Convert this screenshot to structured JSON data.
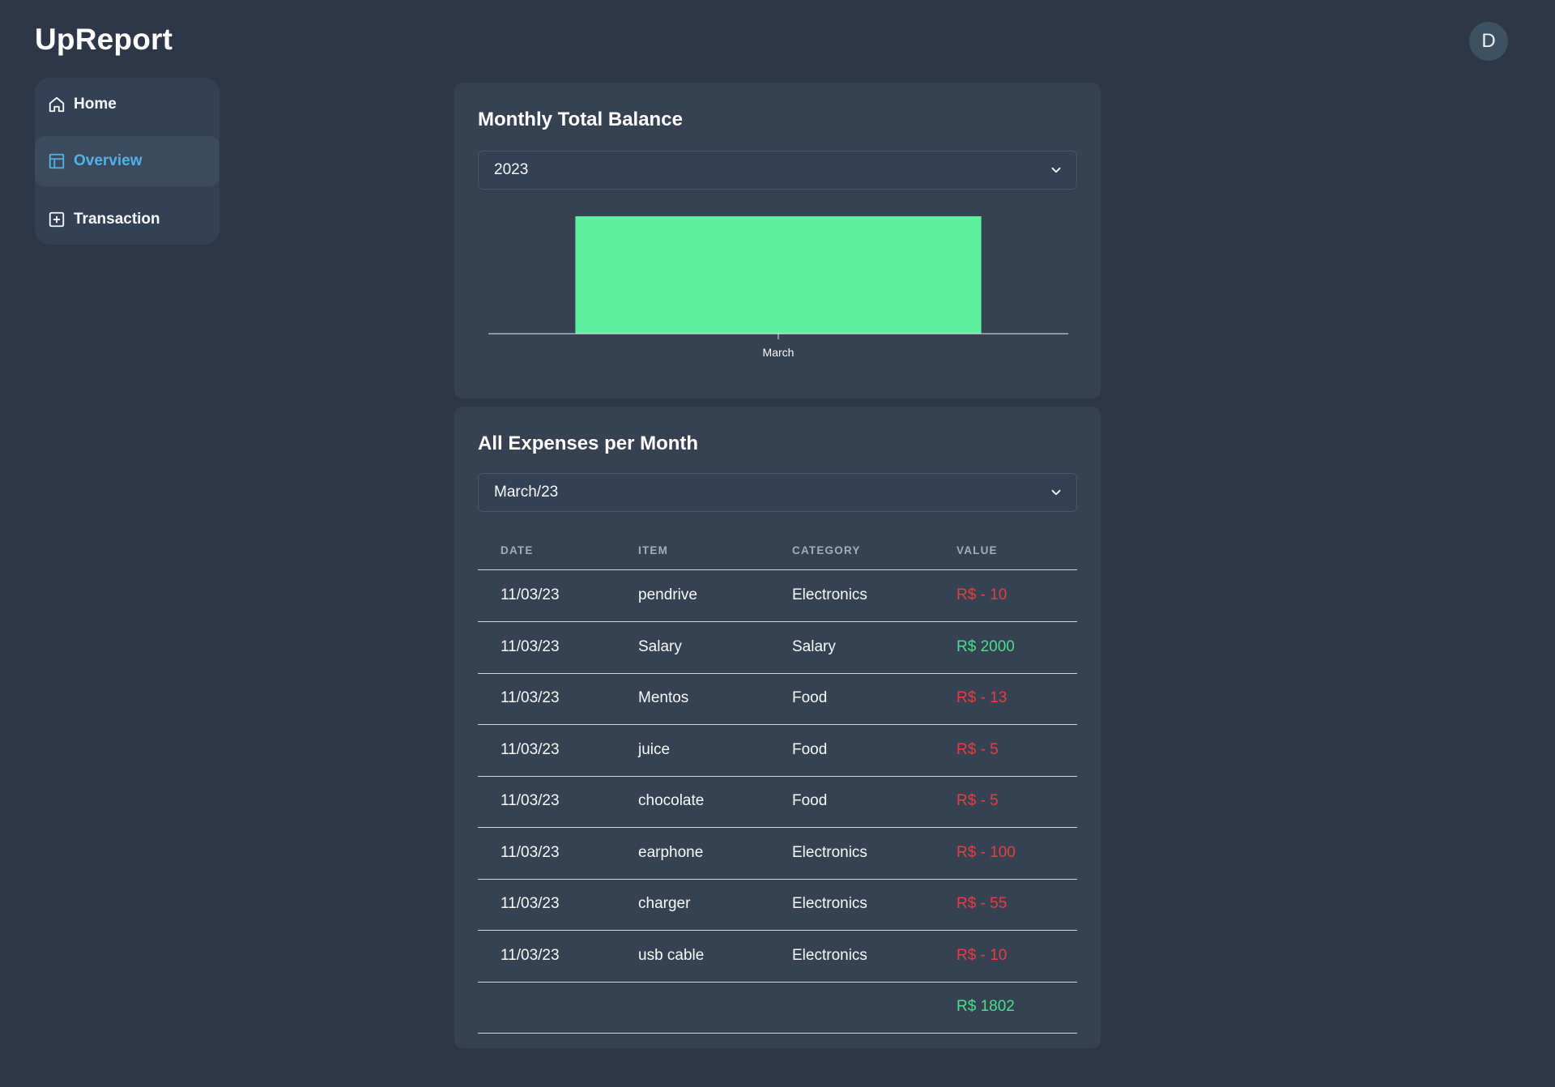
{
  "app": {
    "title": "UpReport"
  },
  "user": {
    "avatar_initial": "D"
  },
  "sidebar": {
    "items": [
      {
        "label": "Home",
        "icon": "home-icon"
      },
      {
        "label": "Overview",
        "icon": "layout-icon",
        "active": true
      },
      {
        "label": "Transaction",
        "icon": "plus-square-icon"
      }
    ]
  },
  "balance_card": {
    "title": "Monthly Total Balance",
    "selected_year": "2023"
  },
  "chart_data": {
    "type": "bar",
    "categories": [
      "March"
    ],
    "values": [
      1802
    ],
    "title": "",
    "xlabel": "",
    "ylabel": "",
    "bar_color": "#5eefa0",
    "grid": false
  },
  "expenses_card": {
    "title": "All Expenses per Month",
    "selected_month": "March/23",
    "columns": [
      "DATE",
      "ITEM",
      "CATEGORY",
      "VALUE"
    ],
    "rows": [
      {
        "date": "11/03/23",
        "item": "pendrive",
        "category": "Electronics",
        "value": "R$ - 10",
        "sign": "neg"
      },
      {
        "date": "11/03/23",
        "item": "Salary",
        "category": "Salary",
        "value": "R$ 2000",
        "sign": "pos"
      },
      {
        "date": "11/03/23",
        "item": "Mentos",
        "category": "Food",
        "value": "R$ - 13",
        "sign": "neg"
      },
      {
        "date": "11/03/23",
        "item": "juice",
        "category": "Food",
        "value": "R$ - 5",
        "sign": "neg"
      },
      {
        "date": "11/03/23",
        "item": "chocolate",
        "category": "Food",
        "value": "R$ - 5",
        "sign": "neg"
      },
      {
        "date": "11/03/23",
        "item": "earphone",
        "category": "Electronics",
        "value": "R$ - 100",
        "sign": "neg"
      },
      {
        "date": "11/03/23",
        "item": "charger",
        "category": "Electronics",
        "value": "R$ - 55",
        "sign": "neg"
      },
      {
        "date": "11/03/23",
        "item": "usb cable",
        "category": "Electronics",
        "value": "R$ - 10",
        "sign": "neg"
      }
    ],
    "total": "R$ 1802"
  },
  "colors": {
    "background": "#2d3748",
    "card": "#364152",
    "accent": "#4fb3e8",
    "negative": "#e53e3e",
    "positive": "#48e08c"
  }
}
